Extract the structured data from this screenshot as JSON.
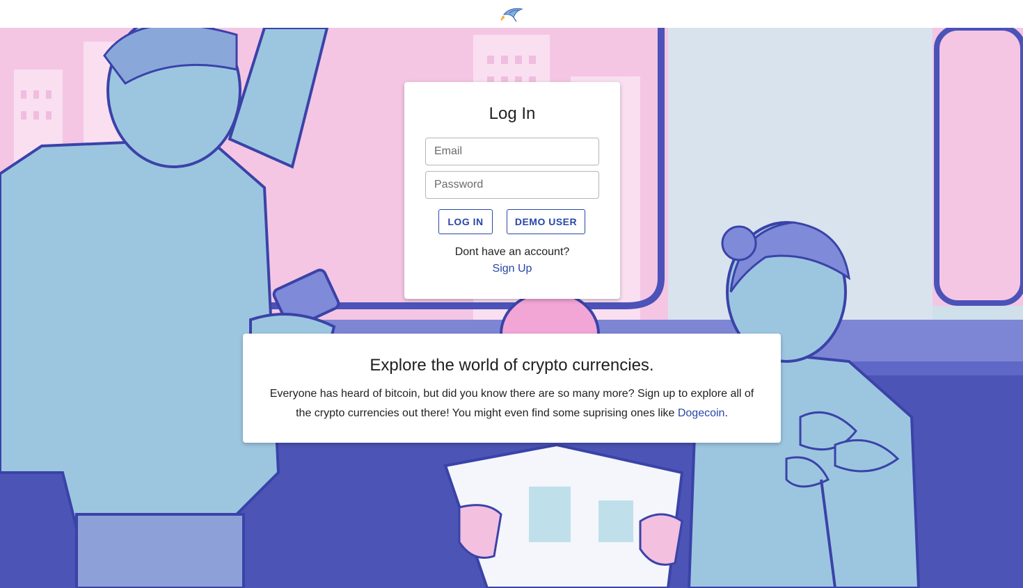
{
  "header": {
    "logo_icon": "bird-logo-icon"
  },
  "login": {
    "title": "Log In",
    "email_placeholder": "Email",
    "email_value": "",
    "password_placeholder": "Password",
    "password_value": "",
    "login_button": "LOG IN",
    "demo_button": "DEMO USER",
    "no_account_text": "Dont have an account?",
    "signup_link": "Sign Up"
  },
  "info": {
    "title": "Explore the world of crypto currencies.",
    "text_before_link": "Everyone has heard of bitcoin, but did you know there are so many more? Sign up to explore all of the crypto currencies out there! You might even find some suprising ones like ",
    "link_text": "Dogecoin",
    "text_after_link": "."
  },
  "colors": {
    "accent": "#2846a8",
    "illustration_pink": "#f4c6e4",
    "illustration_blue": "#5a63c4",
    "illustration_skin": "#9cc6e0"
  }
}
